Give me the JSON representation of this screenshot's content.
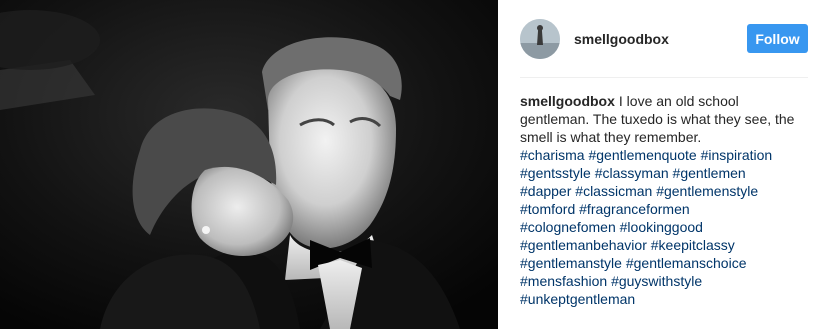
{
  "post": {
    "username": "smellgoodbox",
    "follow_label": "Follow",
    "caption_author": "smellgoodbox",
    "caption_text": "I love an old school gentleman. The tuxedo is what they see, the smell is what they remember.",
    "hashtag_lines": [
      [
        "#charisma",
        "#gentlemenquote",
        "#inspiration"
      ],
      [
        "#gentsstyle",
        "#classyman",
        "#gentlemen"
      ],
      [
        "#dapper",
        "#classicman",
        "#gentlemenstyle"
      ],
      [
        "#tomford",
        "#fragranceformen"
      ],
      [
        "#colognefomen",
        "#lookinggood"
      ],
      [
        "#gentlemanbehavior",
        "#keepitclassy"
      ],
      [
        "#gentlemanstyle",
        "#gentlemanschoice"
      ],
      [
        "#mensfashion",
        "#guyswithstyle"
      ],
      [
        "#unkeptgentleman"
      ]
    ]
  },
  "colors": {
    "follow_button": "#3897f0",
    "hashtag": "#003569",
    "text": "#262626"
  }
}
